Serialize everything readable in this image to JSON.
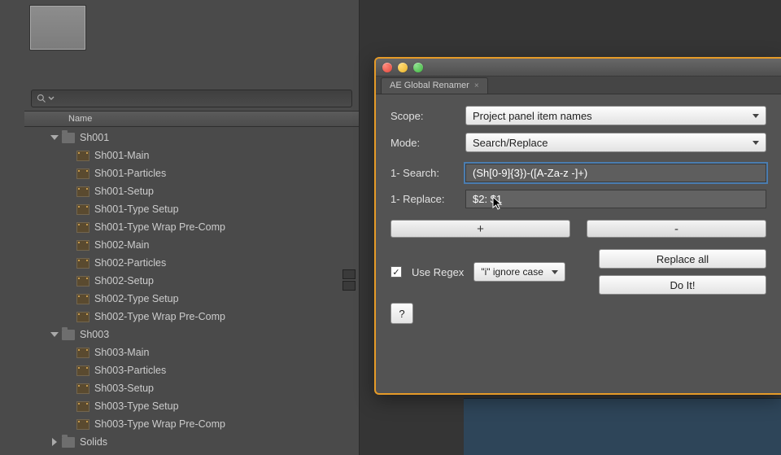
{
  "project": {
    "search_placeholder": "",
    "column_header": "Name",
    "items": [
      {
        "type": "folder",
        "open": true,
        "label": "Sh001"
      },
      {
        "type": "comp",
        "label": "Sh001-Main"
      },
      {
        "type": "comp",
        "label": "Sh001-Particles"
      },
      {
        "type": "comp",
        "label": "Sh001-Setup"
      },
      {
        "type": "comp",
        "label": "Sh001-Type Setup"
      },
      {
        "type": "comp",
        "label": "Sh001-Type Wrap Pre-Comp"
      },
      {
        "type": "comp",
        "label": "Sh002-Main"
      },
      {
        "type": "comp",
        "label": "Sh002-Particles"
      },
      {
        "type": "comp",
        "label": "Sh002-Setup"
      },
      {
        "type": "comp",
        "label": "Sh002-Type Setup"
      },
      {
        "type": "comp",
        "label": "Sh002-Type Wrap Pre-Comp"
      },
      {
        "type": "folder",
        "open": true,
        "label": "Sh003"
      },
      {
        "type": "comp",
        "label": "Sh003-Main"
      },
      {
        "type": "comp",
        "label": "Sh003-Particles"
      },
      {
        "type": "comp",
        "label": "Sh003-Setup"
      },
      {
        "type": "comp",
        "label": "Sh003-Type Setup"
      },
      {
        "type": "comp",
        "label": "Sh003-Type Wrap Pre-Comp"
      },
      {
        "type": "folder",
        "open": false,
        "label": "Solids"
      }
    ]
  },
  "window": {
    "tab_title": "AE Global Renamer",
    "labels": {
      "scope": "Scope:",
      "mode": "Mode:",
      "search": "1- Search:",
      "replace": "1- Replace:",
      "use_regex": "Use Regex"
    },
    "scope_value": "Project panel item names",
    "mode_value": "Search/Replace",
    "search_value": "(Sh[0-9]{3})-([A-Za-z -]+)",
    "replace_value": "$2: $1",
    "plus_label": "+",
    "minus_label": "-",
    "regex_option": "\"i\" ignore case",
    "replace_all_label": "Replace all",
    "doit_label": "Do It!",
    "help_label": "?"
  }
}
